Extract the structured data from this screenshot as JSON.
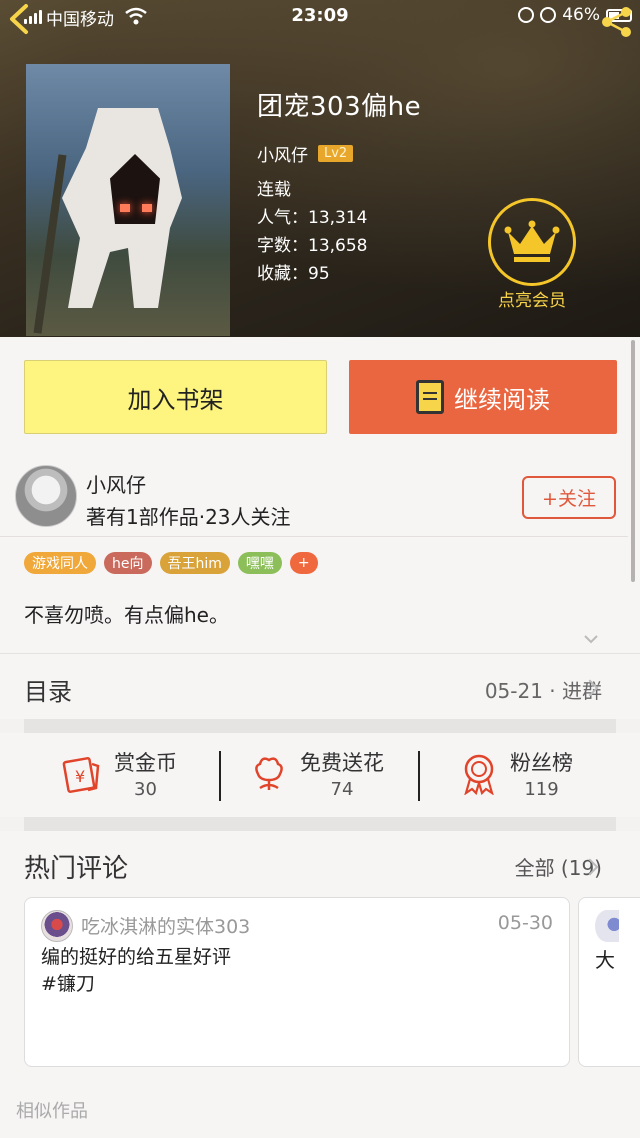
{
  "status_bar": {
    "carrier": "中国移动",
    "time": "23:09",
    "battery": "46%"
  },
  "book": {
    "title": "团宠303偏he",
    "author": "小风仔",
    "level": "Lv2",
    "status": "连载",
    "popularity_label": "人气：",
    "popularity": "13,314",
    "words_label": "字数：",
    "words": "13,658",
    "favorites_label": "收藏：",
    "favorites": "95"
  },
  "vip": {
    "label": "点亮会员",
    "color": "#f5c629"
  },
  "actions": {
    "shelf_label": "加入书架",
    "read_label": "继续阅读",
    "shelf_color": "#fdf57f",
    "read_color": "#ea6640"
  },
  "author_block": {
    "name": "小风仔",
    "stats": "著有1部作品·23人关注",
    "follow_label": "+关注",
    "tags": [
      {
        "label": "游戏同人",
        "color": "#f0a83a"
      },
      {
        "label": "he向",
        "color": "#c96a5c"
      },
      {
        "label": "吾王him",
        "color": "#d9a33a"
      },
      {
        "label": "嘿嘿",
        "color": "#8cbf5a"
      },
      {
        "label": "+",
        "color": "#f0683e"
      }
    ],
    "description": "不喜勿喷。有点偏he。"
  },
  "catalog": {
    "label": "目录",
    "update": "05-21 · 进群"
  },
  "interactions": [
    {
      "title": "赏金币",
      "count": "30",
      "icon": "coin-envelope-icon"
    },
    {
      "title": "免费送花",
      "count": "74",
      "icon": "flower-icon"
    },
    {
      "title": "粉丝榜",
      "count": "119",
      "icon": "medal-icon"
    }
  ],
  "comments": {
    "title": "热门评论",
    "all_label": "全部 (19)",
    "items": [
      {
        "user": "吃冰淇淋的实体303",
        "date": "05-30",
        "line1": "编的挺好的给五星好评",
        "line2": "#镰刀"
      },
      {
        "text": "大"
      }
    ]
  },
  "similar_label": "相似作品"
}
